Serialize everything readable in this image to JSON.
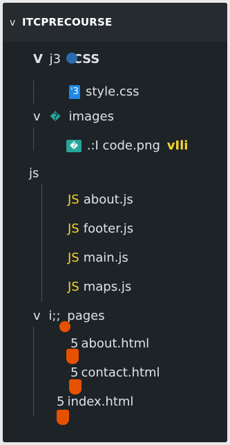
{
  "explorer": {
    "root": {
      "chevron": "v",
      "label": "ITCPRECOURSE"
    },
    "css_folder": {
      "chevron": "V",
      "prefix": "j3",
      "label": "CSS",
      "icon": "css-folder-icon"
    },
    "style_css": {
      "icon_text": "'3",
      "label": "style.css",
      "icon": "css-file-icon"
    },
    "images_folder": {
      "chevron": "v",
      "icon_text": "�",
      "label": "images",
      "icon": "image-folder-icon"
    },
    "code_png": {
      "icon_text": "�",
      "label": ".:I code.png",
      "suffix": "vIli",
      "icon": "image-file-icon"
    },
    "js_folder": {
      "label": "js"
    },
    "js_files": [
      {
        "icon_text": "JS",
        "label": "about.js"
      },
      {
        "icon_text": "JS",
        "label": "footer.js"
      },
      {
        "icon_text": "JS",
        "label": "main.js"
      },
      {
        "icon_text": "JS",
        "label": "maps.js"
      }
    ],
    "pages_folder": {
      "chevron": "v",
      "icon_text": "i;;",
      "label": "pages"
    },
    "pages_files": [
      {
        "num": "5",
        "label": "about.html"
      },
      {
        "num": "5",
        "label": "contact.html"
      }
    ],
    "index_file": {
      "num": "5",
      "label": "index.html"
    }
  },
  "colors": {
    "panel_bg": "#1e2328",
    "header_bg": "#262b30",
    "text": "#dfe3e6",
    "js_yellow": "#f6d32d",
    "css_blue": "#1e88e5",
    "image_teal": "#26a69a",
    "html_orange": "#e65100"
  }
}
